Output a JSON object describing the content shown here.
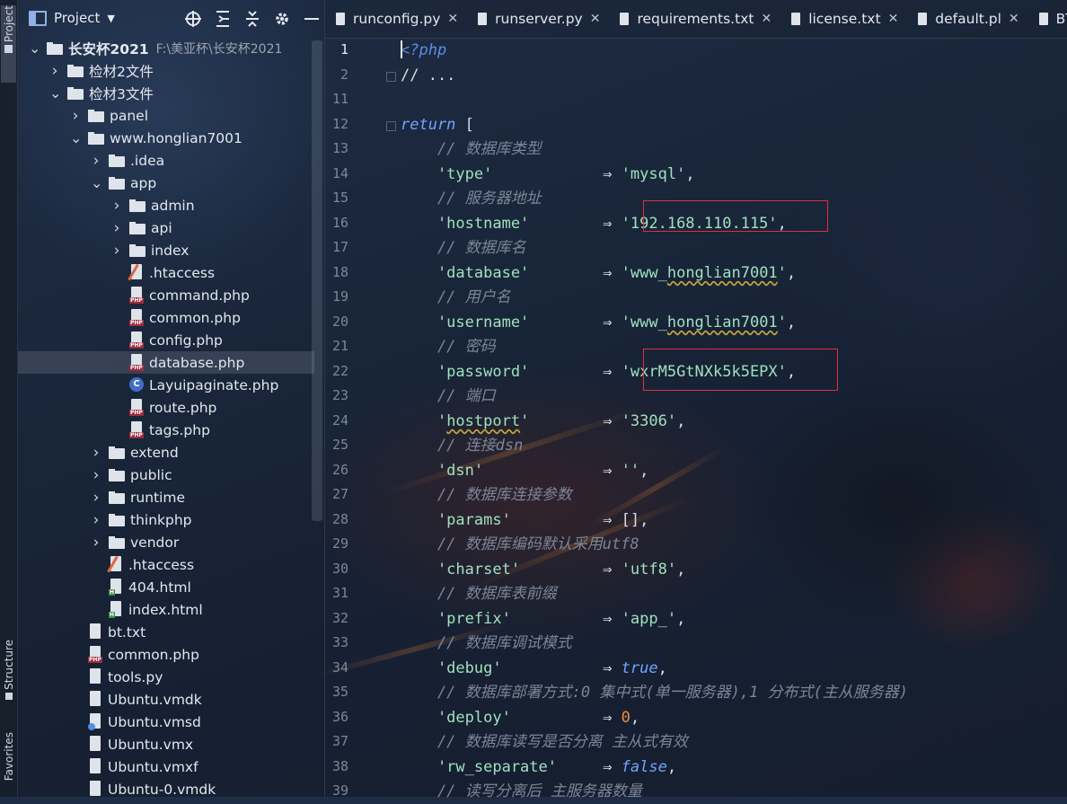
{
  "stripe": {
    "project_tab": "Project",
    "structure_tab": "Structure",
    "favorites_tab": "Favorites"
  },
  "project_panel": {
    "title": "Project",
    "tree": [
      {
        "label": "长安杯2021",
        "path": "F:\\美亚杯\\长安杯2021",
        "type": "folder",
        "open": true
      },
      {
        "label": "检材2文件",
        "type": "folder",
        "open": false
      },
      {
        "label": "检材3文件",
        "type": "folder",
        "open": true
      },
      {
        "label": "panel",
        "type": "folder",
        "open": false
      },
      {
        "label": "www.honglian7001",
        "type": "folder",
        "open": true
      },
      {
        "label": ".idea",
        "type": "folder",
        "open": false
      },
      {
        "label": "app",
        "type": "folder",
        "open": true
      },
      {
        "label": "admin",
        "type": "folder",
        "open": false
      },
      {
        "label": "api",
        "type": "folder",
        "open": false
      },
      {
        "label": "index",
        "type": "folder",
        "open": false
      },
      {
        "label": ".htaccess",
        "type": "htaccess"
      },
      {
        "label": "command.php",
        "type": "php"
      },
      {
        "label": "common.php",
        "type": "php"
      },
      {
        "label": "config.php",
        "type": "php"
      },
      {
        "label": "database.php",
        "type": "php",
        "selected": true
      },
      {
        "label": "Layuipaginate.php",
        "type": "class"
      },
      {
        "label": "route.php",
        "type": "php"
      },
      {
        "label": "tags.php",
        "type": "php"
      },
      {
        "label": "extend",
        "type": "folder",
        "open": false
      },
      {
        "label": "public",
        "type": "folder",
        "open": false
      },
      {
        "label": "runtime",
        "type": "folder",
        "open": false
      },
      {
        "label": "thinkphp",
        "type": "folder",
        "open": false
      },
      {
        "label": "vendor",
        "type": "folder",
        "open": false
      },
      {
        "label": ".htaccess",
        "type": "htaccess"
      },
      {
        "label": "404.html",
        "type": "html"
      },
      {
        "label": "index.html",
        "type": "html"
      },
      {
        "label": "bt.txt",
        "type": "text"
      },
      {
        "label": "common.php",
        "type": "php"
      },
      {
        "label": "tools.py",
        "type": "text"
      },
      {
        "label": "Ubuntu.vmdk",
        "type": "text"
      },
      {
        "label": "Ubuntu.vmsd",
        "type": "vmsd"
      },
      {
        "label": "Ubuntu.vmx",
        "type": "text"
      },
      {
        "label": "Ubuntu.vmxf",
        "type": "text"
      },
      {
        "label": "Ubuntu-0.vmdk",
        "type": "text"
      }
    ]
  },
  "tabs": [
    {
      "label": "runconfig.py"
    },
    {
      "label": "runserver.py"
    },
    {
      "label": "requirements.txt"
    },
    {
      "label": "license.txt"
    },
    {
      "label": "default.pl"
    },
    {
      "label": "BT-T"
    }
  ],
  "editor": {
    "lines": [
      {
        "n": "1",
        "tokens": [
          [
            "tag-php",
            "<?php"
          ]
        ]
      },
      {
        "n": "2",
        "tokens": [
          [
            "pl",
            "// ..."
          ]
        ]
      },
      {
        "n": "11",
        "tokens": []
      },
      {
        "n": "12",
        "tokens": [
          [
            "kw",
            "return"
          ],
          [
            "pl",
            " ["
          ]
        ]
      },
      {
        "n": "13",
        "tokens": [
          [
            "cm",
            "    // 数据库类型"
          ]
        ]
      },
      {
        "n": "14",
        "tokens": [
          [
            "str",
            "    'type'"
          ],
          [
            "ar",
            "            ⇒ "
          ],
          [
            "str",
            "'mysql'"
          ],
          [
            "pl",
            ","
          ]
        ]
      },
      {
        "n": "15",
        "tokens": [
          [
            "cm",
            "    // 服务器地址"
          ]
        ]
      },
      {
        "n": "16",
        "tokens": [
          [
            "str",
            "    'hostname'"
          ],
          [
            "ar",
            "        ⇒ "
          ],
          [
            "str",
            "'192.168.110.115'"
          ],
          [
            "pl",
            ","
          ]
        ]
      },
      {
        "n": "17",
        "tokens": [
          [
            "cm",
            "    // 数据库名"
          ]
        ]
      },
      {
        "n": "18",
        "tokens": [
          [
            "str",
            "    'database'"
          ],
          [
            "ar",
            "        ⇒ "
          ],
          [
            "str",
            "'www_honglian7001'"
          ],
          [
            "pl",
            ","
          ]
        ]
      },
      {
        "n": "19",
        "tokens": [
          [
            "cm",
            "    // 用户名"
          ]
        ]
      },
      {
        "n": "20",
        "tokens": [
          [
            "str",
            "    'username'"
          ],
          [
            "ar",
            "        ⇒ "
          ],
          [
            "str",
            "'www_honglian7001'"
          ],
          [
            "pl",
            ","
          ]
        ]
      },
      {
        "n": "21",
        "tokens": [
          [
            "cm",
            "    // 密码"
          ]
        ]
      },
      {
        "n": "22",
        "tokens": [
          [
            "str",
            "    'password'"
          ],
          [
            "ar",
            "        ⇒ "
          ],
          [
            "str",
            "'wxrM5GtNXk5k5EPX'"
          ],
          [
            "pl",
            ","
          ]
        ]
      },
      {
        "n": "23",
        "tokens": [
          [
            "cm",
            "    // 端口"
          ]
        ]
      },
      {
        "n": "24",
        "tokens": [
          [
            "str",
            "    'hostport'"
          ],
          [
            "ar",
            "        ⇒ "
          ],
          [
            "str",
            "'3306'"
          ],
          [
            "pl",
            ","
          ]
        ]
      },
      {
        "n": "25",
        "tokens": [
          [
            "cm",
            "    // 连接dsn"
          ]
        ]
      },
      {
        "n": "26",
        "tokens": [
          [
            "str",
            "    'dsn'"
          ],
          [
            "ar",
            "             ⇒ "
          ],
          [
            "str",
            "''"
          ],
          [
            "pl",
            ","
          ]
        ]
      },
      {
        "n": "27",
        "tokens": [
          [
            "cm",
            "    // 数据库连接参数"
          ]
        ]
      },
      {
        "n": "28",
        "tokens": [
          [
            "str",
            "    'params'"
          ],
          [
            "ar",
            "          ⇒ "
          ],
          [
            "pl",
            "[],"
          ]
        ]
      },
      {
        "n": "29",
        "tokens": [
          [
            "cm",
            "    // 数据库编码默认采用utf8"
          ]
        ]
      },
      {
        "n": "30",
        "tokens": [
          [
            "str",
            "    'charset'"
          ],
          [
            "ar",
            "         ⇒ "
          ],
          [
            "str",
            "'utf8'"
          ],
          [
            "pl",
            ","
          ]
        ]
      },
      {
        "n": "31",
        "tokens": [
          [
            "cm",
            "    // 数据库表前缀"
          ]
        ]
      },
      {
        "n": "32",
        "tokens": [
          [
            "str",
            "    'prefix'"
          ],
          [
            "ar",
            "          ⇒ "
          ],
          [
            "str",
            "'app_'"
          ],
          [
            "pl",
            ","
          ]
        ]
      },
      {
        "n": "33",
        "tokens": [
          [
            "cm",
            "    // 数据库调试模式"
          ]
        ]
      },
      {
        "n": "34",
        "tokens": [
          [
            "str",
            "    'debug'"
          ],
          [
            "ar",
            "           ⇒ "
          ],
          [
            "bool",
            "true"
          ],
          [
            "pl",
            ","
          ]
        ]
      },
      {
        "n": "35",
        "tokens": [
          [
            "cm",
            "    // 数据库部署方式:0 集中式(单一服务器),1 分布式(主从服务器)"
          ]
        ]
      },
      {
        "n": "36",
        "tokens": [
          [
            "str",
            "    'deploy'"
          ],
          [
            "ar",
            "          ⇒ "
          ],
          [
            "num",
            "0"
          ],
          [
            "pl",
            ","
          ]
        ]
      },
      {
        "n": "37",
        "tokens": [
          [
            "cm",
            "    // 数据库读写是否分离 主从式有效"
          ]
        ]
      },
      {
        "n": "38",
        "tokens": [
          [
            "str",
            "    'rw_separate'"
          ],
          [
            "ar",
            "     ⇒ "
          ],
          [
            "bool",
            "false"
          ],
          [
            "pl",
            ","
          ]
        ]
      },
      {
        "n": "39",
        "tokens": [
          [
            "cm",
            "    // 读写分离后 主服务器数量"
          ]
        ]
      }
    ]
  },
  "colors": {
    "keyword": "#6fa4ff",
    "string": "#9fe0be",
    "comment": "#7b8597",
    "number": "#f28a3e",
    "highlight_box": "#e0303a"
  }
}
